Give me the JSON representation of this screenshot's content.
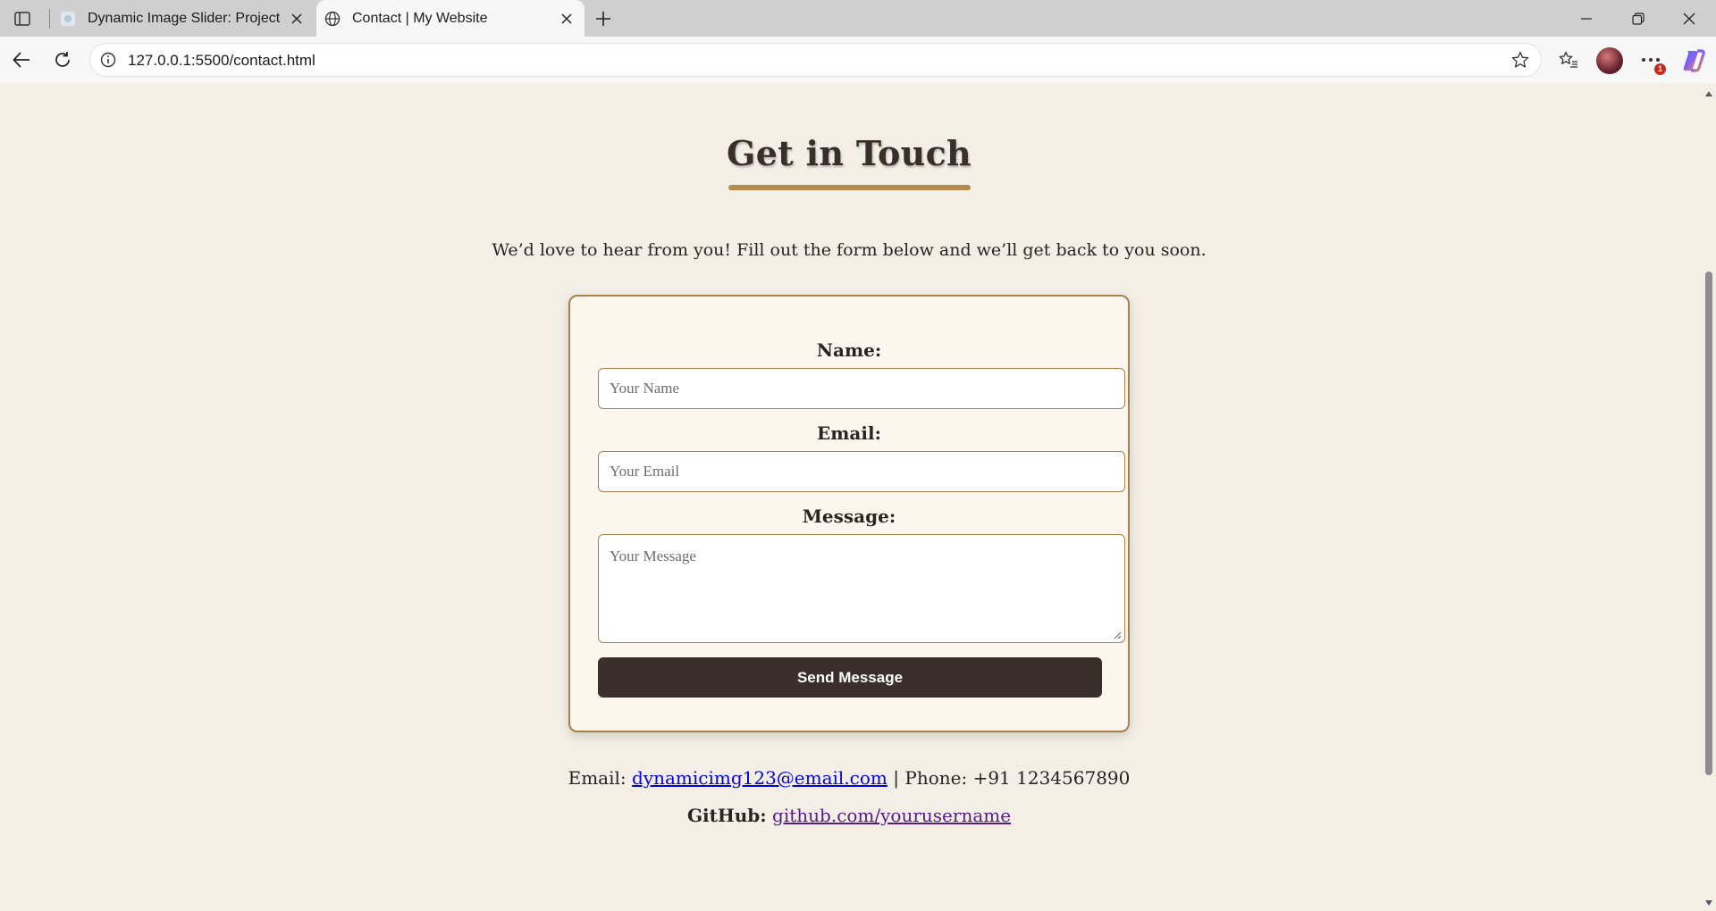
{
  "browser": {
    "tabs": [
      {
        "title": "Dynamic Image Slider: Project Pho",
        "active": false
      },
      {
        "title": "Contact | My Website",
        "active": true
      }
    ],
    "address_bar": {
      "url": "127.0.0.1:5500/contact.html"
    },
    "notification_count": "1"
  },
  "page": {
    "heading": "Get in Touch",
    "intro": "We’d love to hear from you! Fill out the form below and we’ll get back to you soon.",
    "form": {
      "name_label": "Name:",
      "name_placeholder": "Your Name",
      "email_label": "Email:",
      "email_placeholder": "Your Email",
      "message_label": "Message:",
      "message_placeholder": "Your Message",
      "submit_label": "Send Message"
    },
    "contact": {
      "email_prefix": "Email:",
      "email": "dynamicimg123@email.com",
      "separator": "|",
      "phone_label": "Phone:",
      "phone": "+91 1234567890",
      "github_label": "GitHub:",
      "github_link": "github.com/yourusername"
    }
  },
  "colors": {
    "page_background": "#f4efe6",
    "accent": "#b58c4e",
    "button": "#3b2f2e",
    "card_background": "#fdf6ef"
  }
}
